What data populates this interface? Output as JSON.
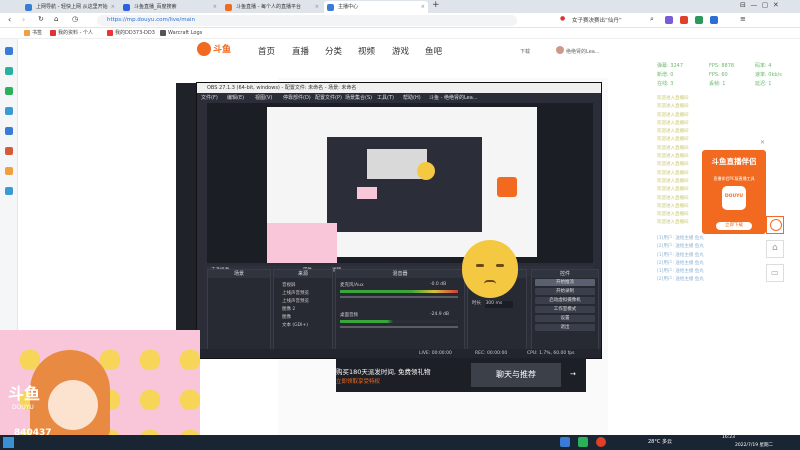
{
  "tabs": [
    {
      "label": "上网导航 - 轻快上网 从这里开始"
    },
    {
      "label": "斗鱼直播_百度搜索"
    },
    {
      "label": "斗鱼直播 - 每个人的直播平台"
    },
    {
      "label": "主播中心"
    }
  ],
  "address": {
    "url": "https://mp.douyu.com/live/main"
  },
  "search": {
    "placeholder": "女子赛决赛出“仙丹”"
  },
  "bookmarks": [
    {
      "label": "书签"
    },
    {
      "label": "我的资料 - 个人"
    },
    {
      "label": "我的DD373-DD3"
    },
    {
      "label": "Warcraft Logs"
    }
  ],
  "nav": {
    "logo_text": "斗鱼",
    "items": [
      "首页",
      "直播",
      "分类",
      "视频",
      "游戏",
      "鱼吧"
    ],
    "download": "下载",
    "user": "绝绝肾的Lea..."
  },
  "obs": {
    "title": "OBS 27.1.3 (64-bit, windows) - 配置文件: 未命名 - 场景: 未命名",
    "menu": [
      "文件(F)",
      "编辑(E)",
      "视图(V)",
      "停靠部件(D)",
      "配置文件(P)",
      "场景集合(S)",
      "工具(T)",
      "帮助(H)",
      "斗鱼 - 绝绝肾的Lea..."
    ],
    "selected_source": "未选择源",
    "props_btn": "属性",
    "filters_btn": "滤镜",
    "docks": {
      "scenes": "场景",
      "sources": "来源",
      "mixer": "混音器",
      "transitions": "转场",
      "controls": "控件"
    },
    "sources": [
      "音视屏",
      "上线声音预览",
      "上线声音预览",
      "图像 2",
      "图像",
      "文本 (GDI+)"
    ],
    "mixer": [
      {
        "name": "麦克风/Aux",
        "db": "-0.0 dB"
      },
      {
        "name": "桌面音频",
        "db": "-24.9 dB"
      }
    ],
    "duration_label": "时长",
    "duration_value": "300 ms",
    "controls": [
      "开始推流",
      "开始录制",
      "启动虚拟摄像机",
      "工作室模式",
      "设置",
      "退出"
    ],
    "status": {
      "live": "LIVE: 00:00:00",
      "rec": "REC: 00:00:00",
      "cpu": "CPU: 1.7%, 60.00 fps"
    }
  },
  "stats": {
    "left": [
      "弹幕: 3247",
      "新增: 0",
      "在线: 3"
    ],
    "mid": [
      "FPS: 8878",
      "FPS: 60",
      "丢帧: 1"
    ],
    "right": [
      "码率: 4",
      "速率: 0kb/s",
      "延迟: 1"
    ]
  },
  "chat_joined": [
    "欢迎进入直播间",
    "欢迎进入直播间",
    "欢迎进入直播间",
    "欢迎进入直播间",
    "欢迎进入直播间",
    "欢迎进入直播间",
    "欢迎进入直播间",
    "欢迎进入直播间",
    "欢迎进入直播间",
    "欢迎进入直播间",
    "欢迎进入直播间",
    "欢迎进入直播间",
    "欢迎进入直播间",
    "欢迎进入直播间",
    "欢迎进入直播间",
    "欢迎进入直播间"
  ],
  "chat_gifts": [
    "[1]用户: 送给主播 鱼丸",
    "[2]用户: 送给主播 鱼丸",
    "[1]用户: 送给主播 鱼丸",
    "[2]用户: 送给主播 鱼丸",
    "[1]用户: 送给主播 鱼丸",
    "[2]用户: 送给主播 鱼丸"
  ],
  "promo": {
    "title": "斗鱼直播伴侣",
    "subtitle": "直播伴侣PC版直播工具",
    "brand": "DOUYU",
    "download": "立即下载"
  },
  "banner": {
    "text": "购买180天派发时间, 免费领礼物",
    "sub": "立即领取享受特权",
    "chat_button": "聊天与推荐"
  },
  "sticker": {
    "brand": "斗鱼",
    "brand_en": "DOUYU",
    "room_id": "840437"
  },
  "taskbar": {
    "weather": "28°C 多云",
    "time": "16:23",
    "date": "2022/7/19 星期二"
  },
  "colors": {
    "accent": "#f26a20",
    "obs_bg": "#2b2e38",
    "link": "#2a6fd6"
  }
}
